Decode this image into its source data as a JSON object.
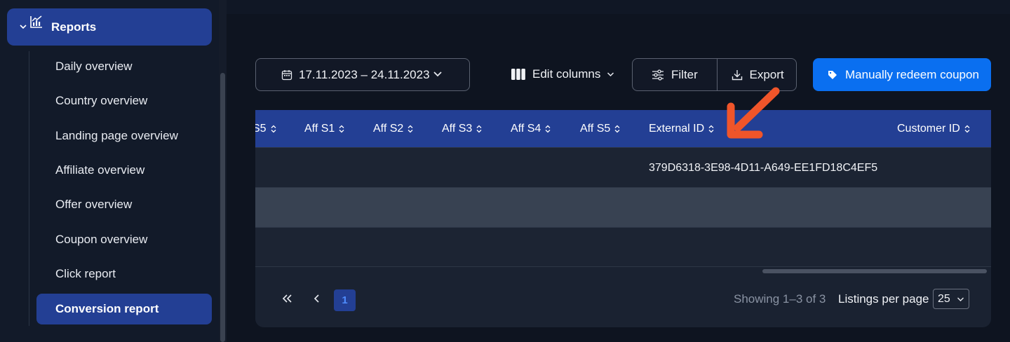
{
  "sidebar": {
    "section_label": "Reports",
    "items": [
      {
        "label": "Daily overview"
      },
      {
        "label": "Country overview"
      },
      {
        "label": "Landing page overview"
      },
      {
        "label": "Affiliate overview"
      },
      {
        "label": "Offer overview"
      },
      {
        "label": "Coupon overview"
      },
      {
        "label": "Click report"
      },
      {
        "label": "Conversion report",
        "active": true
      }
    ]
  },
  "toolbar": {
    "date_range": "17.11.2023 – 24.11.2023",
    "edit_columns_label": "Edit columns",
    "filter_label": "Filter",
    "export_label": "Export",
    "redeem_label": "Manually redeem coupon"
  },
  "table": {
    "columns": [
      "S5",
      "Aff S1",
      "Aff S2",
      "Aff S3",
      "Aff S4",
      "Aff S5",
      "External ID",
      "Customer ID"
    ],
    "rows": [
      {
        "external_id": "379D6318-3E98-4D11-A649-EE1FD18C4EF5",
        "customer_id": ""
      },
      {
        "external_id": "",
        "customer_id": ""
      },
      {
        "external_id": "",
        "customer_id": ""
      }
    ]
  },
  "pagination": {
    "current_page": "1",
    "showing_text": "Showing 1–3 of 3",
    "listings_label": "Listings per page",
    "per_page_value": "25"
  },
  "colors": {
    "primary": "#233f94",
    "accent_button": "#0a6ff0",
    "annotation_arrow": "#f0552a",
    "background": "#0e1420"
  },
  "icons": [
    "chevron-down-icon",
    "reports-chart-icon",
    "calendar-icon",
    "columns-icon",
    "filter-sliders-icon",
    "download-icon",
    "tag-icon",
    "sort-icon",
    "double-chevron-left-icon",
    "chevron-left-icon",
    "annotation-arrow"
  ]
}
